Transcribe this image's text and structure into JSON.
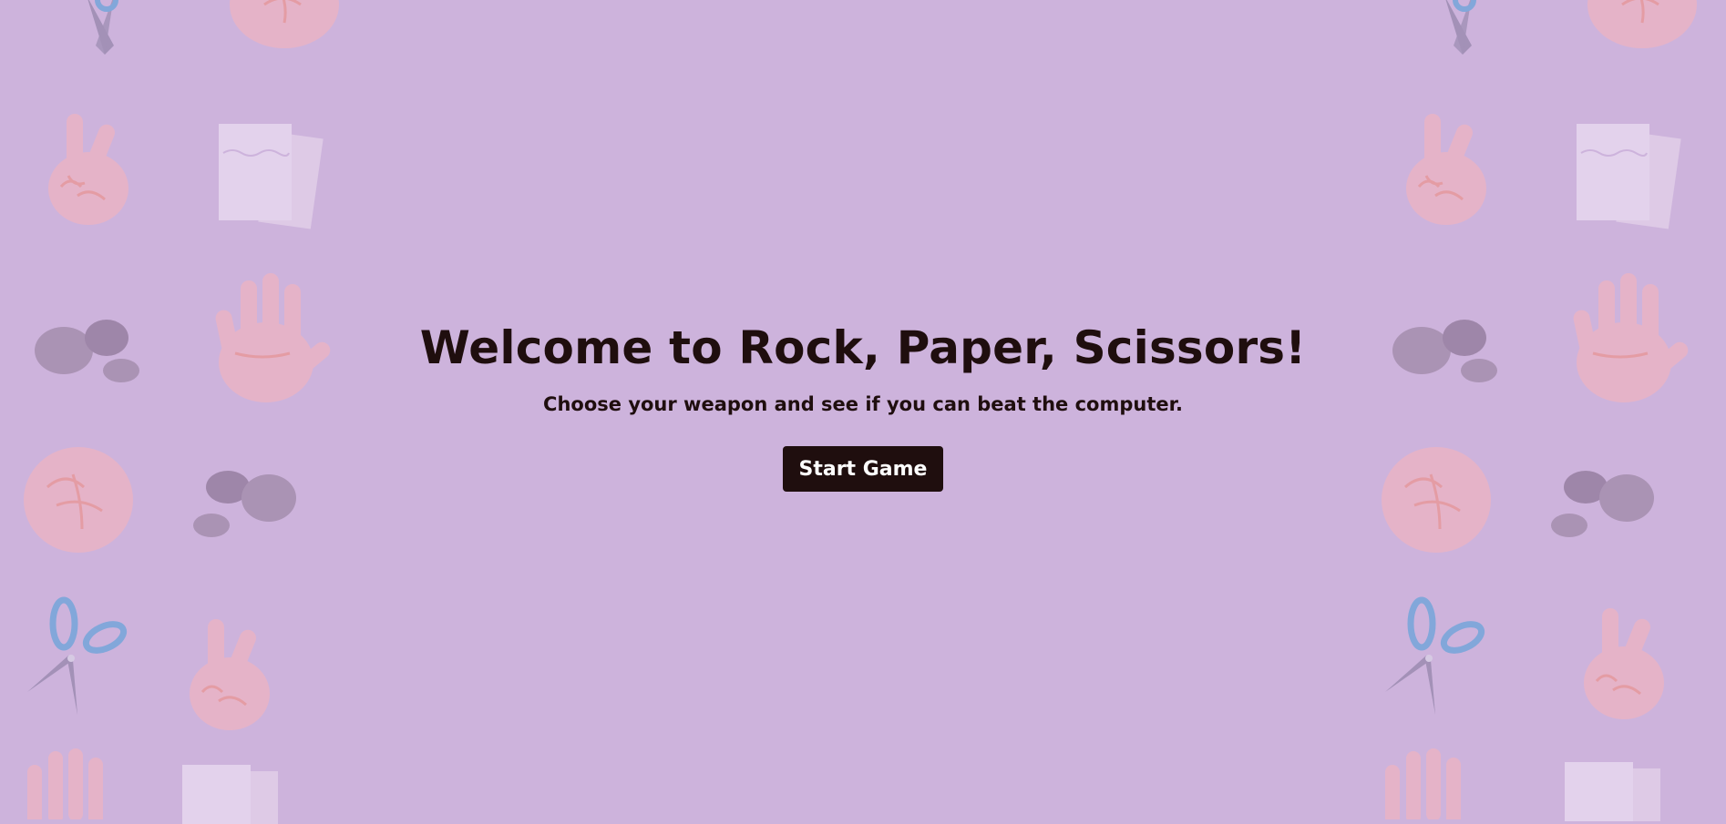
{
  "page": {
    "background_color": "#cdb3dc",
    "text_color": "#1f0e0e"
  },
  "welcome": {
    "title": "Welcome to Rock, Paper, Scissors!",
    "subtitle": "Choose your weapon and see if you can beat the computer.",
    "start_button_label": "Start Game"
  },
  "decorations": {
    "icons": [
      "scissors-icon",
      "fist-icon",
      "peace-hand-icon",
      "paper-icon",
      "rocks-icon",
      "open-hand-icon"
    ],
    "colors": {
      "hand": "#e8b4c6",
      "hand_line": "#e79a9e",
      "paper": "#e0cde8",
      "rock": "#a790b0",
      "scissors_blade": "#9f8eb4",
      "scissors_handle": "#7aa6da"
    }
  }
}
